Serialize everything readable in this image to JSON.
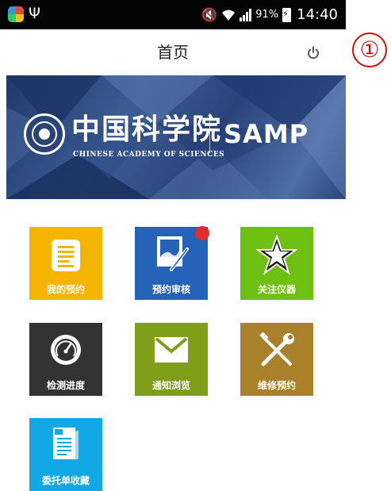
{
  "status_bar": {
    "battery": "91%",
    "time": "14:40"
  },
  "header": {
    "title": "首页",
    "marker": "①"
  },
  "banner": {
    "cn_name": "中国科学院",
    "en_name": "CHINESE ACADEMY OF SCIENCES",
    "product": "SAMP"
  },
  "tiles": [
    {
      "label": "我的预约",
      "icon": "notes-icon",
      "color": "#f5b400"
    },
    {
      "label": "预约审核",
      "icon": "image-edit-icon",
      "color": "#2463b7",
      "badge": true
    },
    {
      "label": "关注仪器",
      "icon": "star-icon",
      "color": "#6ec012"
    },
    {
      "label": "检测进度",
      "icon": "gauge-icon",
      "color": "#333333"
    },
    {
      "label": "通知浏览",
      "icon": "mail-icon",
      "color": "#7f9e1a"
    },
    {
      "label": "维修预约",
      "icon": "tools-icon",
      "color": "#a9812b"
    },
    {
      "label": "委托单收藏",
      "icon": "documents-icon",
      "color": "#11a8e5"
    }
  ],
  "colors": {
    "accent_badge": "#e52a2a",
    "status_bar": "#050505",
    "banner": "#2f4b80"
  }
}
